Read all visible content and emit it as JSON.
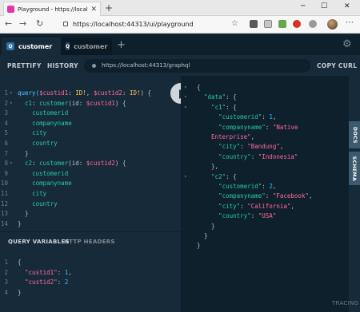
{
  "browser": {
    "tab_title": "Playground - https://localhost:44",
    "url": "https://localhost:44313/ui/playground"
  },
  "playground": {
    "tabs": [
      {
        "badge": "Q",
        "label": "customer",
        "active": true
      },
      {
        "badge": "Q",
        "label": "customer",
        "active": false
      }
    ],
    "toolbar": {
      "prettify": "PRETTIFY",
      "history": "HISTORY",
      "endpoint": "https://localhost:44313/graphql",
      "copy_curl": "COPY CURL"
    },
    "query_lines": [
      {
        "n": "1",
        "fold": "▾",
        "tokens": [
          [
            "kw",
            "query("
          ],
          [
            "var",
            "$custid1"
          ],
          [
            "pun",
            ": "
          ],
          [
            "typ",
            "ID!"
          ],
          [
            "pun",
            ", "
          ],
          [
            "var",
            "$custid2"
          ],
          [
            "pun",
            ": "
          ],
          [
            "typ",
            "ID!"
          ],
          [
            "pun",
            ") {"
          ]
        ]
      },
      {
        "n": "2",
        "fold": "▾",
        "tokens": [
          [
            "pun",
            "  "
          ],
          [
            "fld",
            "c1"
          ],
          [
            "pun",
            ": "
          ],
          [
            "fld",
            "customer"
          ],
          [
            "pun",
            "(id: "
          ],
          [
            "var",
            "$custid1"
          ],
          [
            "pun",
            ") {"
          ]
        ]
      },
      {
        "n": "3",
        "fold": "",
        "tokens": [
          [
            "pun",
            "    "
          ],
          [
            "fld",
            "customerid"
          ]
        ]
      },
      {
        "n": "4",
        "fold": "",
        "tokens": [
          [
            "pun",
            "    "
          ],
          [
            "fld",
            "companyname"
          ]
        ]
      },
      {
        "n": "5",
        "fold": "",
        "tokens": [
          [
            "pun",
            "    "
          ],
          [
            "fld",
            "city"
          ]
        ]
      },
      {
        "n": "6",
        "fold": "",
        "tokens": [
          [
            "pun",
            "    "
          ],
          [
            "fld",
            "country"
          ]
        ]
      },
      {
        "n": "7",
        "fold": "",
        "tokens": [
          [
            "pun",
            "  }"
          ]
        ]
      },
      {
        "n": "8",
        "fold": "▾",
        "tokens": [
          [
            "pun",
            "  "
          ],
          [
            "fld",
            "c2"
          ],
          [
            "pun",
            ": "
          ],
          [
            "fld",
            "customer"
          ],
          [
            "pun",
            "(id: "
          ],
          [
            "var",
            "$custid2"
          ],
          [
            "pun",
            ") {"
          ]
        ]
      },
      {
        "n": "9",
        "fold": "",
        "tokens": [
          [
            "pun",
            "    "
          ],
          [
            "fld",
            "customerid"
          ]
        ]
      },
      {
        "n": "10",
        "fold": "",
        "tokens": [
          [
            "pun",
            "    "
          ],
          [
            "fld",
            "companyname"
          ]
        ]
      },
      {
        "n": "11",
        "fold": "",
        "tokens": [
          [
            "pun",
            "    "
          ],
          [
            "fld",
            "city"
          ]
        ]
      },
      {
        "n": "12",
        "fold": "",
        "tokens": [
          [
            "pun",
            "    "
          ],
          [
            "fld",
            "country"
          ]
        ]
      },
      {
        "n": "13",
        "fold": "",
        "tokens": [
          [
            "pun",
            "  }"
          ]
        ]
      },
      {
        "n": "14",
        "fold": "",
        "tokens": [
          [
            "pun",
            "}"
          ]
        ]
      }
    ],
    "variables_tabs": {
      "query_variables": "QUERY VARIABLES",
      "http_headers": "HTTP HEADERS"
    },
    "variables_lines": [
      {
        "n": "1",
        "tokens": [
          [
            "pun",
            "{"
          ]
        ]
      },
      {
        "n": "2",
        "tokens": [
          [
            "pun",
            "  "
          ],
          [
            "str",
            "\"custid1\""
          ],
          [
            "pun",
            ": "
          ],
          [
            "num",
            "1"
          ],
          [
            "pun",
            ","
          ]
        ]
      },
      {
        "n": "3",
        "tokens": [
          [
            "pun",
            "  "
          ],
          [
            "str",
            "\"custid2\""
          ],
          [
            "pun",
            ": "
          ],
          [
            "num",
            "2"
          ]
        ]
      },
      {
        "n": "4",
        "tokens": [
          [
            "pun",
            "}"
          ]
        ]
      }
    ],
    "result_lines": [
      {
        "fold": "▾",
        "indent": 10,
        "tokens": [
          [
            "pun",
            "{"
          ]
        ]
      },
      {
        "fold": "▾",
        "indent": 10,
        "tokens": [
          [
            "pun",
            "  "
          ],
          [
            "key",
            "\"data\""
          ],
          [
            "pun",
            ": {"
          ]
        ]
      },
      {
        "fold": "▾",
        "indent": 10,
        "tokens": [
          [
            "pun",
            "    "
          ],
          [
            "key",
            "\"c1\""
          ],
          [
            "pun",
            ": {"
          ]
        ]
      },
      {
        "fold": "",
        "indent": 10,
        "tokens": [
          [
            "pun",
            "      "
          ],
          [
            "key",
            "\"customerid\""
          ],
          [
            "pun",
            ": "
          ],
          [
            "num",
            "1"
          ],
          [
            "pun",
            ","
          ]
        ]
      },
      {
        "fold": "",
        "indent": 10,
        "tokens": [
          [
            "pun",
            "      "
          ],
          [
            "key",
            "\"companyname\""
          ],
          [
            "pun",
            ": "
          ],
          [
            "str",
            "\"Native"
          ]
        ]
      },
      {
        "fold": "",
        "indent": 28,
        "tokens": [
          [
            "str",
            "Enterprise\""
          ],
          [
            "pun",
            ","
          ]
        ]
      },
      {
        "fold": "",
        "indent": 10,
        "tokens": [
          [
            "pun",
            "      "
          ],
          [
            "key",
            "\"city\""
          ],
          [
            "pun",
            ": "
          ],
          [
            "str",
            "\"Bandung\""
          ],
          [
            "pun",
            ","
          ]
        ]
      },
      {
        "fold": "",
        "indent": 10,
        "tokens": [
          [
            "pun",
            "      "
          ],
          [
            "key",
            "\"country\""
          ],
          [
            "pun",
            ": "
          ],
          [
            "str",
            "\"Indonesia\""
          ]
        ]
      },
      {
        "fold": "",
        "indent": 10,
        "tokens": [
          [
            "pun",
            "    },"
          ]
        ]
      },
      {
        "fold": "▾",
        "indent": 10,
        "tokens": [
          [
            "pun",
            "    "
          ],
          [
            "key",
            "\"c2\""
          ],
          [
            "pun",
            ": {"
          ]
        ]
      },
      {
        "fold": "",
        "indent": 10,
        "tokens": [
          [
            "pun",
            "      "
          ],
          [
            "key",
            "\"customerid\""
          ],
          [
            "pun",
            ": "
          ],
          [
            "num",
            "2"
          ],
          [
            "pun",
            ","
          ]
        ]
      },
      {
        "fold": "",
        "indent": 10,
        "tokens": [
          [
            "pun",
            "      "
          ],
          [
            "key",
            "\"companyname\""
          ],
          [
            "pun",
            ": "
          ],
          [
            "str",
            "\"Facebook\""
          ],
          [
            "pun",
            ","
          ]
        ]
      },
      {
        "fold": "",
        "indent": 10,
        "tokens": [
          [
            "pun",
            "      "
          ],
          [
            "key",
            "\"city\""
          ],
          [
            "pun",
            ": "
          ],
          [
            "str",
            "\"California\""
          ],
          [
            "pun",
            ","
          ]
        ]
      },
      {
        "fold": "",
        "indent": 10,
        "tokens": [
          [
            "pun",
            "      "
          ],
          [
            "key",
            "\"country\""
          ],
          [
            "pun",
            ": "
          ],
          [
            "str",
            "\"USA\""
          ]
        ]
      },
      {
        "fold": "",
        "indent": 10,
        "tokens": [
          [
            "pun",
            "    }"
          ]
        ]
      },
      {
        "fold": "",
        "indent": 10,
        "tokens": [
          [
            "pun",
            "  }"
          ]
        ]
      },
      {
        "fold": "",
        "indent": 10,
        "tokens": [
          [
            "pun",
            "}"
          ]
        ]
      }
    ],
    "side_tabs": {
      "docs": "DOCS",
      "schema": "SCHEMA"
    },
    "tracing": "TRACING"
  }
}
